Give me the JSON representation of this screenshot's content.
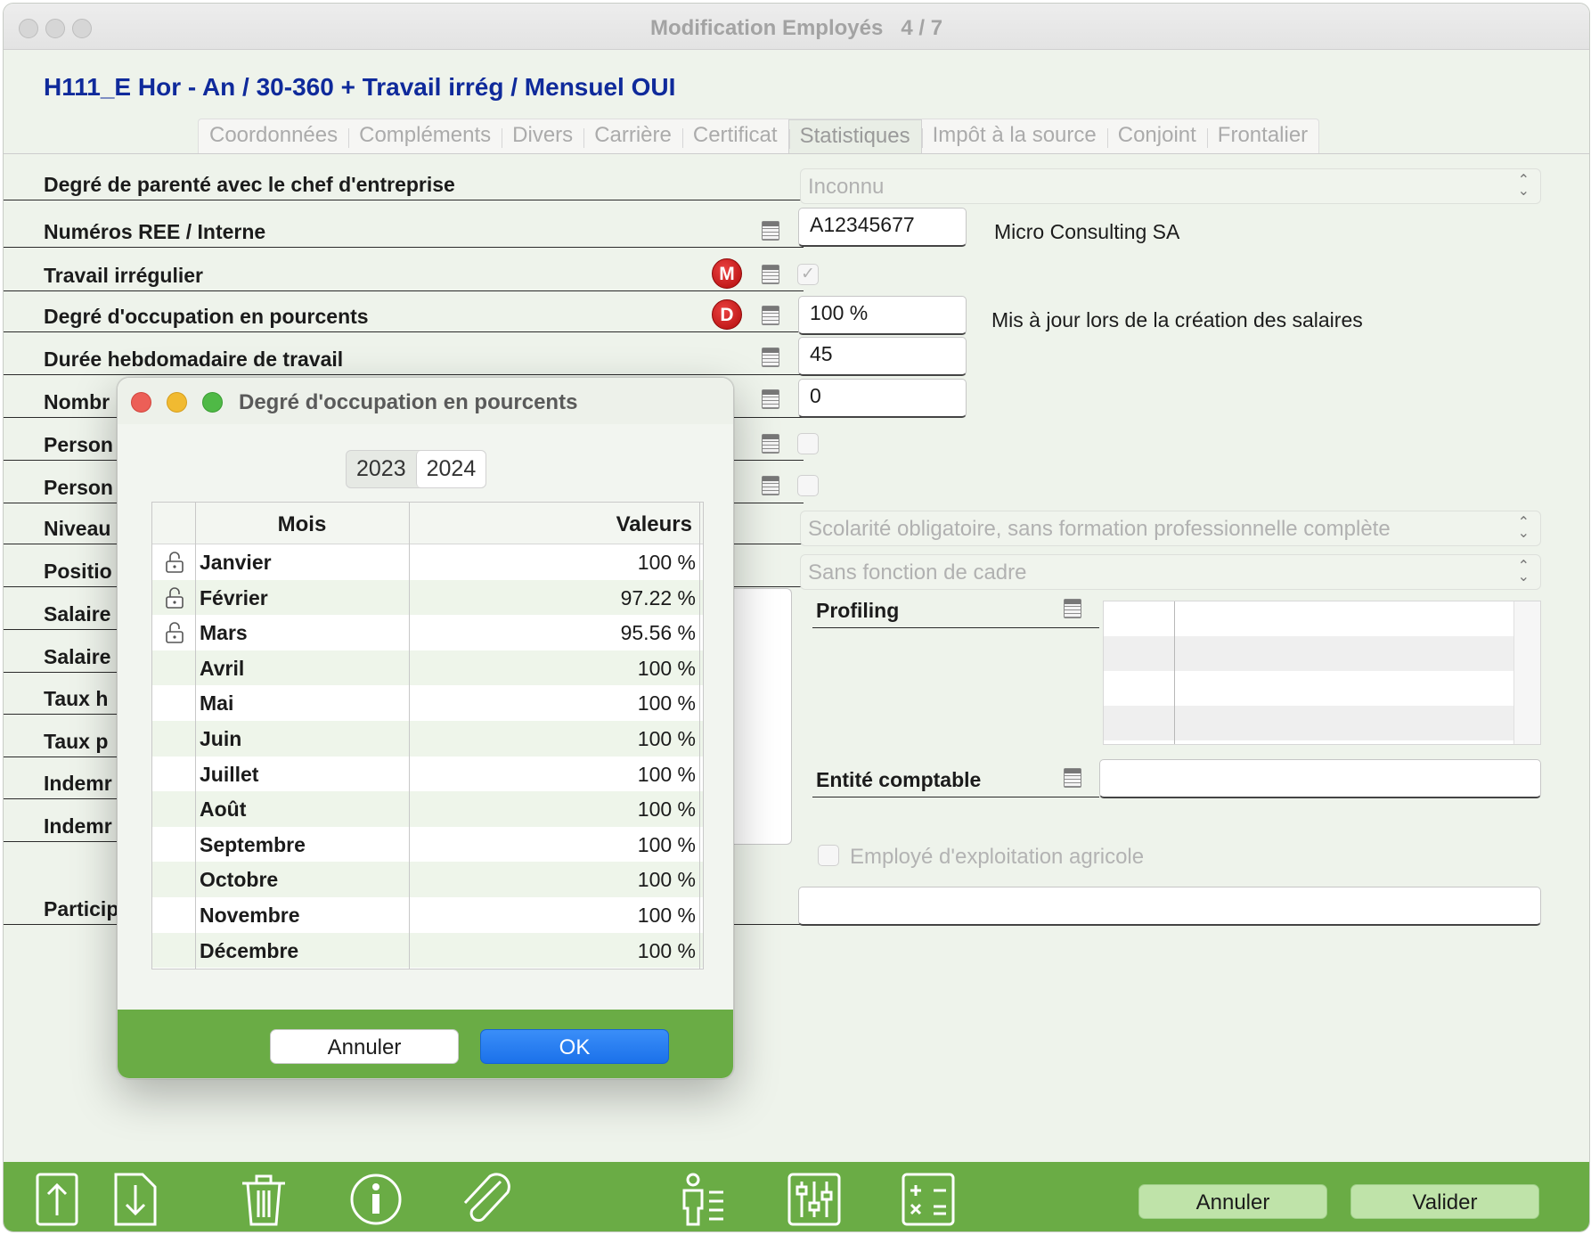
{
  "window": {
    "title": "Modification Employés",
    "page_indicator": "4 / 7",
    "employee_header": "H111_E Hor - An / 30-360 + Travail irrég / Mensuel OUI"
  },
  "tabs": [
    {
      "label": "Coordonnées"
    },
    {
      "label": "Compléments"
    },
    {
      "label": "Divers"
    },
    {
      "label": "Carrière"
    },
    {
      "label": "Certificat"
    },
    {
      "label": "Statistiques",
      "active": true
    },
    {
      "label": "Impôt à la source"
    },
    {
      "label": "Conjoint"
    },
    {
      "label": "Frontalier"
    }
  ],
  "form": {
    "parente_label": "Degré de parenté avec le chef d'entreprise",
    "parente_value": "Inconnu",
    "ree_label": "Numéros REE / Interne",
    "ree_value": "A12345677",
    "company_name": "Micro Consulting SA",
    "irregular_label": "Travail irrégulier",
    "irregular_checked": true,
    "badge_m": "M",
    "badge_d": "D",
    "occupation_label": "Degré d'occupation en pourcents",
    "occupation_value": "100 %",
    "occupation_note": "Mis à jour lors de la création des salaires",
    "weekly_label": "Durée hebdomadaire de travail",
    "weekly_value": "45",
    "row6_label": "Nombr",
    "row6_value": "0",
    "row7_label": "Person",
    "row8_label": "Person",
    "row9_label": "Niveau",
    "formation_value": "Scolarité obligatoire, sans formation professionnelle complète",
    "row10_label": "Positio",
    "position_value": "Sans fonction de cadre",
    "row11_label": "Salaire",
    "row12_label": "Salaire",
    "row13_label": "Taux h",
    "row14_label": "Taux p",
    "row15_label": "Indemr",
    "row16_label": "Indemr",
    "row17_label": "Particip",
    "profiling_label": "Profiling",
    "entity_label": "Entité comptable",
    "entity_value": "",
    "agri_label": "Employé d'exploitation agricole",
    "partic_value": ""
  },
  "dialog": {
    "title": "Degré d'occupation en pourcents",
    "years": [
      "2023",
      "2024"
    ],
    "selected_year": "2024",
    "col_month": "Mois",
    "col_value": "Valeurs",
    "months": [
      {
        "name": "Janvier",
        "value": "100 %",
        "locked": true
      },
      {
        "name": "Février",
        "value": "97.22 %",
        "locked": true
      },
      {
        "name": "Mars",
        "value": "95.56 %",
        "locked": true
      },
      {
        "name": "Avril",
        "value": "100 %",
        "locked": false
      },
      {
        "name": "Mai",
        "value": "100 %",
        "locked": false
      },
      {
        "name": "Juin",
        "value": "100 %",
        "locked": false
      },
      {
        "name": "Juillet",
        "value": "100 %",
        "locked": false
      },
      {
        "name": "Août",
        "value": "100 %",
        "locked": false
      },
      {
        "name": "Septembre",
        "value": "100 %",
        "locked": false
      },
      {
        "name": "Octobre",
        "value": "100 %",
        "locked": false
      },
      {
        "name": "Novembre",
        "value": "100 %",
        "locked": false
      },
      {
        "name": "Décembre",
        "value": "100 %",
        "locked": false
      }
    ],
    "cancel_label": "Annuler",
    "ok_label": "OK"
  },
  "footer": {
    "icons": [
      "upload-icon",
      "download-icon",
      "trash-icon",
      "info-icon",
      "paperclip-icon",
      "person-list-icon",
      "sliders-icon",
      "calculator-icon"
    ],
    "cancel_label": "Annuler",
    "validate_label": "Valider"
  },
  "colors": {
    "accent_green": "#6aac45",
    "header_blue": "#0f2a9b",
    "badge_red": "#c81818",
    "ok_blue": "#1976f0",
    "row_alt": "#eef5ea"
  }
}
